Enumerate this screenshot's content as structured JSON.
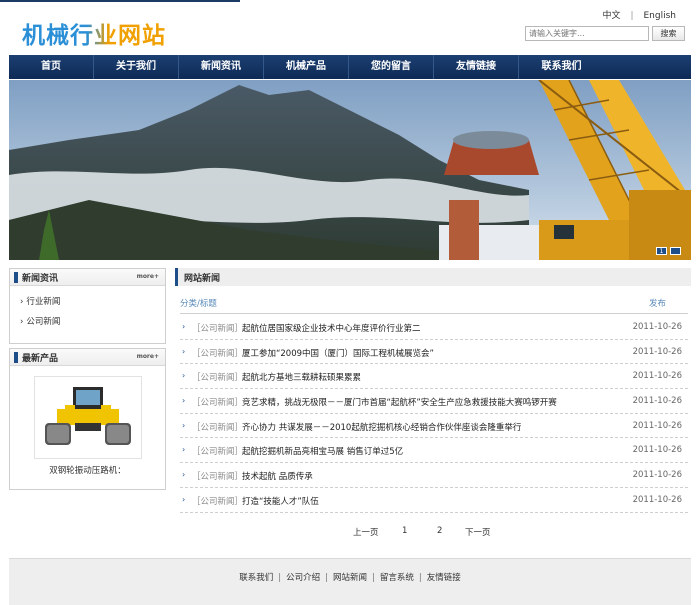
{
  "header": {
    "logo_text": "机械行业网站",
    "lang_zh": "中文",
    "lang_sep": "|",
    "lang_en": "English",
    "search_placeholder": "请输入关键字...",
    "search_button": "搜索"
  },
  "nav": {
    "items": [
      "首页",
      "关于我们",
      "新闻资讯",
      "机械产品",
      "您的留言",
      "友情链接",
      "联系我们"
    ]
  },
  "banner": {
    "indicator_1": "1"
  },
  "sidebar": {
    "news": {
      "title": "新闻资讯",
      "more": "more+",
      "items": [
        "行业新闻",
        "公司新闻"
      ]
    },
    "products": {
      "title": "最新产品",
      "more": "more+",
      "item_name": "双钢轮振动压路机："
    }
  },
  "news_panel": {
    "title": "网站新闻",
    "col_category": "分类/标题",
    "col_date": "发布",
    "rows": [
      {
        "category": "［公司新闻］",
        "title": "起航位居国家级企业技术中心年度评价行业第二",
        "date": "2011-10-26"
      },
      {
        "category": "［公司新闻］",
        "title": "厦工参加“2009中国（厦门）国际工程机械展览会”",
        "date": "2011-10-26"
      },
      {
        "category": "［公司新闻］",
        "title": "起航北方基地三载耕耘硕果累累",
        "date": "2011-10-26"
      },
      {
        "category": "［公司新闻］",
        "title": "竞艺求精，挑战无极限－－厦门市首届“起航杯”安全生产应急救援技能大赛鸣锣开赛",
        "date": "2011-10-26"
      },
      {
        "category": "［公司新闻］",
        "title": "齐心协力 共谋发展－－2010起航挖掘机核心经销合作伙伴座谈会隆重举行",
        "date": "2011-10-26"
      },
      {
        "category": "［公司新闻］",
        "title": "起航挖掘机新品亮相宝马展 销售订单过5亿",
        "date": "2011-10-26"
      },
      {
        "category": "［公司新闻］",
        "title": "技术起航 品质传承",
        "date": "2011-10-26"
      },
      {
        "category": "［公司新闻］",
        "title": "打造“技能人才”队伍",
        "date": "2011-10-26"
      }
    ]
  },
  "pager": {
    "prev": "上一页",
    "page1": "1",
    "page2": "2",
    "next": "下一页"
  },
  "footer": {
    "links": [
      "联系我们",
      "公司介绍",
      "网站新闻",
      "留言系统",
      "友情链接"
    ],
    "sep": "|"
  },
  "colors": {
    "nav_bg": "#1c3f72",
    "accent": "#1d4e8a",
    "category_text": "#8a8a8a",
    "column_header": "#5a8ab8"
  }
}
